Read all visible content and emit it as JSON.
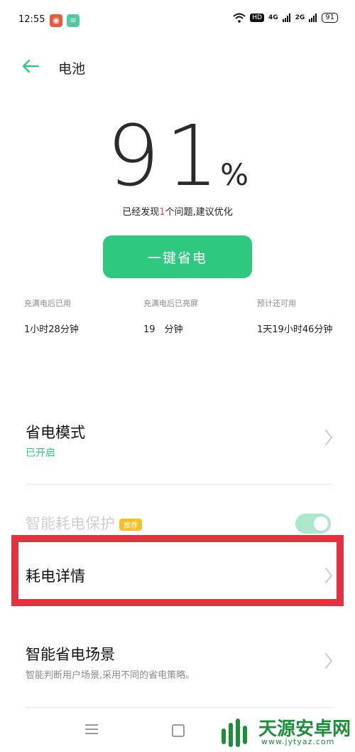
{
  "status_bar": {
    "time": "12:55",
    "hd": "HD",
    "net_a": "4G",
    "net_b": "2G",
    "battery": "91",
    "notif_a": "◉",
    "notif_b": "≡"
  },
  "header": {
    "title": "电池"
  },
  "battery": {
    "percent": "91",
    "percent_sign": "%",
    "issue_prefix": "已经发现",
    "issue_count": "1",
    "issue_suffix": "个问题,建议优化"
  },
  "one_key_button": "一键省电",
  "stats": [
    {
      "label": "充满电后已用",
      "value": "1小时28分钟"
    },
    {
      "label": "充满电后已亮屏",
      "value": "19　分钟"
    },
    {
      "label": "预计还可用",
      "value": "1天19小时46分钟"
    }
  ],
  "settings": {
    "power_saving": {
      "title": "省电模式",
      "status": "已开启"
    },
    "smart_protection": {
      "title": "智能耗电保护",
      "tag": "推荐",
      "enabled": true
    },
    "power_details": {
      "title": "耗电详情"
    },
    "smart_scenes": {
      "title": "智能省电场景",
      "subtitle": "智能判断用户场景,采用不同的省电策略。"
    }
  },
  "watermark": {
    "name": "天源安卓网",
    "url": "www.jytyaz.com"
  },
  "colors": {
    "accent": "#2ec97e",
    "highlight": "#e0333f",
    "issue": "#e8503a",
    "tag": "#f5c026"
  }
}
